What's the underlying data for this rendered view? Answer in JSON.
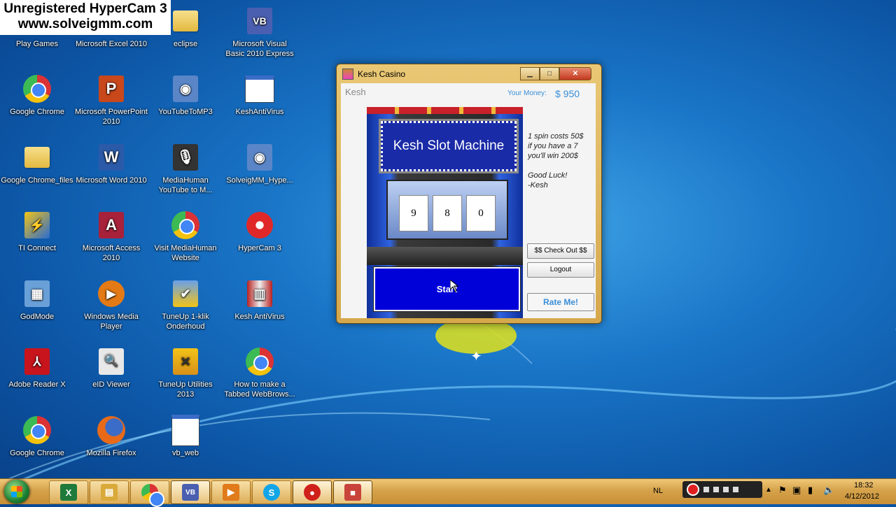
{
  "watermark": {
    "line1": "Unregistered HyperCam 3",
    "line2": "www.solveigmm.com"
  },
  "desktop_icons": [
    {
      "label": "Play Games",
      "icon": "games-icon"
    },
    {
      "label": "Microsoft Excel 2010",
      "icon": "excel-icon"
    },
    {
      "label": "eclipse",
      "icon": "folder-icon"
    },
    {
      "label": "Microsoft Visual Basic 2010 Express",
      "icon": "visual-basic-icon"
    },
    {
      "label": "Google Chrome",
      "icon": "chrome-icon"
    },
    {
      "label": "Microsoft PowerPoint 2010",
      "icon": "powerpoint-icon"
    },
    {
      "label": "YouTubeToMP3",
      "icon": "computer-cd-icon"
    },
    {
      "label": "KeshAntiVirus",
      "icon": "app-window-icon"
    },
    {
      "label": "Google Chrome_files",
      "icon": "folder-icon"
    },
    {
      "label": "Microsoft Word 2010",
      "icon": "word-icon"
    },
    {
      "label": "MediaHuman YouTube to M...",
      "icon": "microphone-icon"
    },
    {
      "label": "SolveigMM_Hype...",
      "icon": "computer-cd-icon"
    },
    {
      "label": "TI Connect",
      "icon": "ti-connect-icon"
    },
    {
      "label": "Microsoft Access 2010",
      "icon": "access-icon"
    },
    {
      "label": "Visit MediaHuman Website",
      "icon": "chrome-icon"
    },
    {
      "label": "HyperCam 3",
      "icon": "hypercam-icon"
    },
    {
      "label": "GodMode",
      "icon": "control-panel-icon"
    },
    {
      "label": "Windows Media Player",
      "icon": "media-player-icon"
    },
    {
      "label": "TuneUp 1-klik Onderhoud",
      "icon": "tuneup-icon"
    },
    {
      "label": "Kesh AntiVirus",
      "icon": "antivirus-icon"
    },
    {
      "label": "Adobe Reader X",
      "icon": "adobe-reader-icon"
    },
    {
      "label": "eID Viewer",
      "icon": "eid-viewer-icon"
    },
    {
      "label": "TuneUp Utilities 2013",
      "icon": "tuneup-utilities-icon"
    },
    {
      "label": "How to make a Tabbed WebBrows...",
      "icon": "chrome-icon"
    },
    {
      "label": "Google Chrome",
      "icon": "chrome-icon"
    },
    {
      "label": "Mozilla Firefox",
      "icon": "firefox-icon"
    },
    {
      "label": "vb_web",
      "icon": "vb-project-icon"
    }
  ],
  "window": {
    "title": "Kesh Casino",
    "min_glyph": "▁",
    "max_glyph": "□",
    "close_glyph": "✕",
    "user_name": "Kesh",
    "money_label": "Your Money:",
    "money_value": "$ 950",
    "machine_title": "Kesh Slot Machine",
    "reels": [
      "9",
      "8",
      "0"
    ],
    "start_label": "Start",
    "info": "1 spin costs 50$\nif you have a 7\nyou'll win 200$\n\nGood Luck!\n-Kesh",
    "checkout_label": "$$ Check Out $$",
    "logout_label": "Logout",
    "rate_label": "Rate Me!"
  },
  "taskbar": {
    "language": "NL",
    "time": "18:32",
    "date": "4/12/2012",
    "items": [
      {
        "name": "excel",
        "glyph": "X",
        "color": "#1d7a3a"
      },
      {
        "name": "explorer",
        "glyph": "▤",
        "color": "#d9a93a"
      },
      {
        "name": "chrome",
        "glyph": "",
        "color": "#db3236"
      },
      {
        "name": "visual-basic",
        "glyph": "VB",
        "color": "#4a5fb0"
      },
      {
        "name": "media-player",
        "glyph": "▶",
        "color": "#e07a1a"
      },
      {
        "name": "skype",
        "glyph": "S",
        "color": "#12a5e8"
      },
      {
        "name": "hypercam",
        "glyph": "●",
        "color": "#d0201a"
      },
      {
        "name": "kesh-casino",
        "glyph": "■",
        "color": "#c8443a"
      }
    ]
  }
}
